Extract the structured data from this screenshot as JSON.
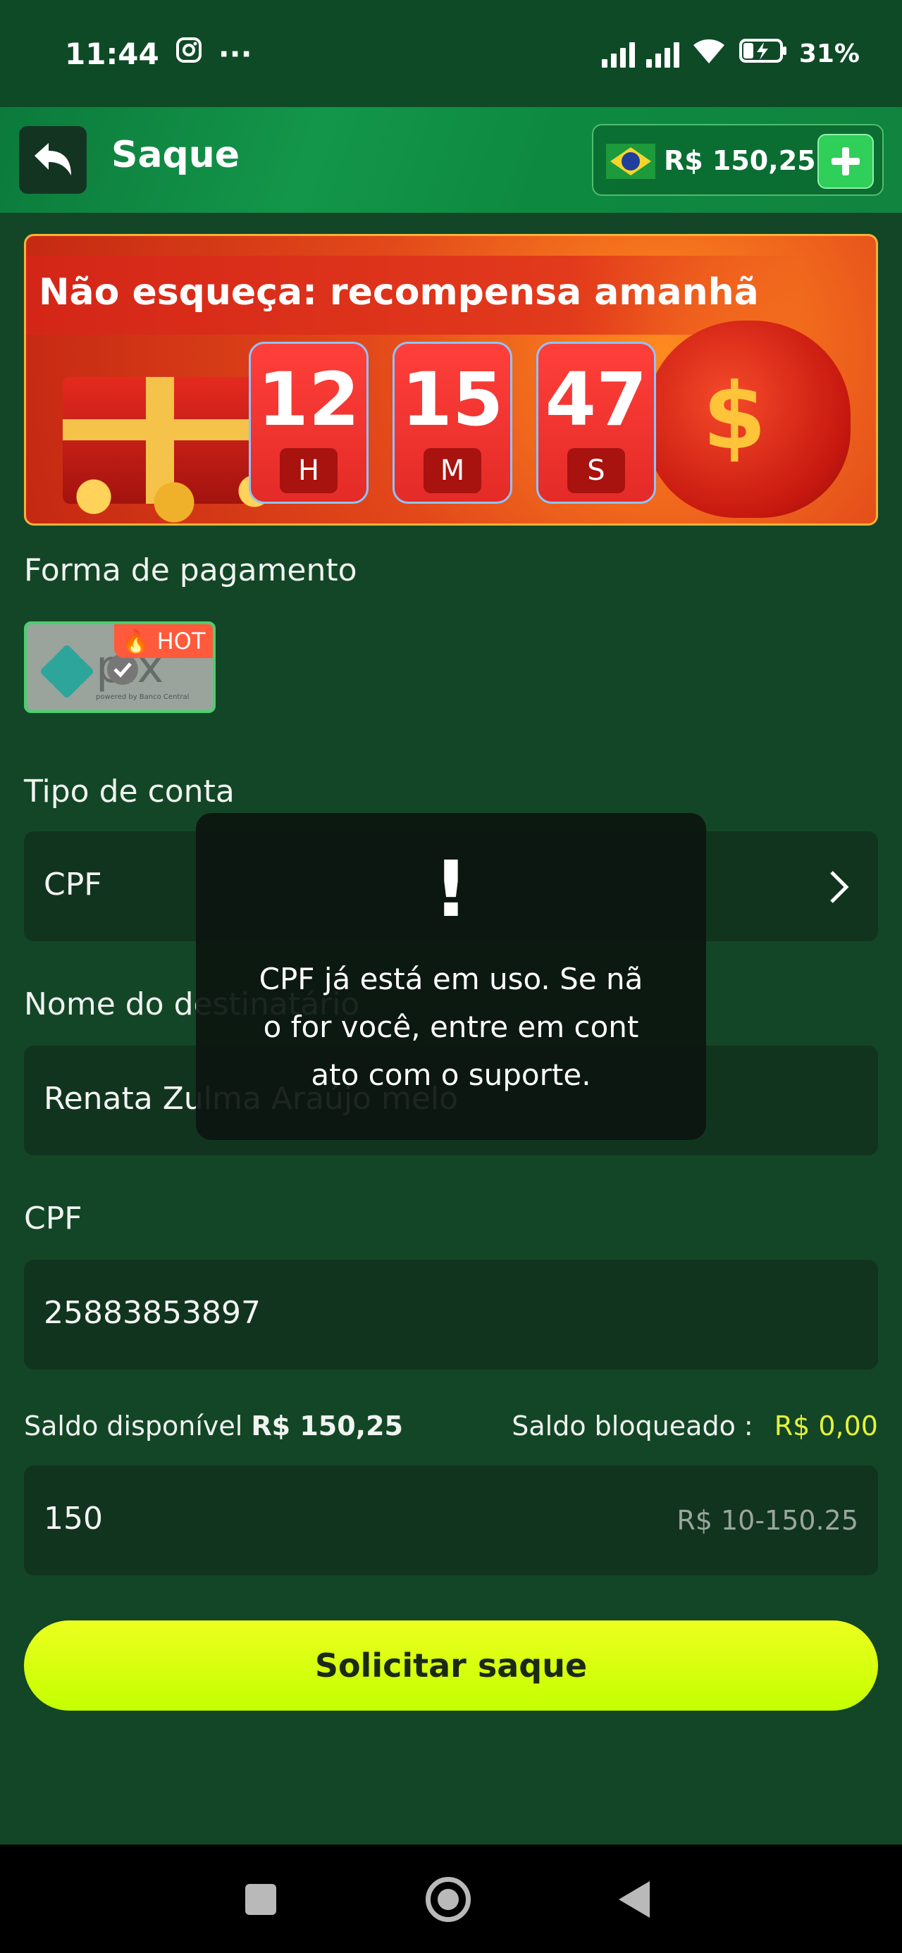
{
  "status_bar": {
    "time": "11:44",
    "more": "···",
    "battery": "31%"
  },
  "header": {
    "title": "Saque",
    "balance": "R$ 150,25"
  },
  "banner": {
    "title": "Não esqueça: recompensa amanhã",
    "timer": [
      {
        "value": "12",
        "unit": "H"
      },
      {
        "value": "15",
        "unit": "M"
      },
      {
        "value": "47",
        "unit": "S"
      }
    ]
  },
  "payment": {
    "label": "Forma de pagamento",
    "method": "pix",
    "method_sub": "powered by Banco Central",
    "badge": "HOT"
  },
  "account_type": {
    "label": "Tipo de conta",
    "value": "CPF"
  },
  "recipient": {
    "label": "Nome do destinatário",
    "value": "Renata Zulma Araújo melo"
  },
  "cpf": {
    "label": "CPF",
    "value": "25883853897"
  },
  "saldo": {
    "available_label": "Saldo disponível",
    "available_value": "R$ 150,25",
    "blocked_label": "Saldo bloqueado :",
    "blocked_value": "R$ 0,00"
  },
  "amount": {
    "value": "150",
    "range": "R$ 10-150.25"
  },
  "submit_label": "Solicitar saque",
  "toast": {
    "icon": "!",
    "message": "CPF já está em uso. Se nã\no for você, entre em cont\nato com o suporte."
  },
  "colors": {
    "background": "#134626",
    "accent_button": "#d8ff10",
    "blocked_amount": "#e6f23a"
  }
}
